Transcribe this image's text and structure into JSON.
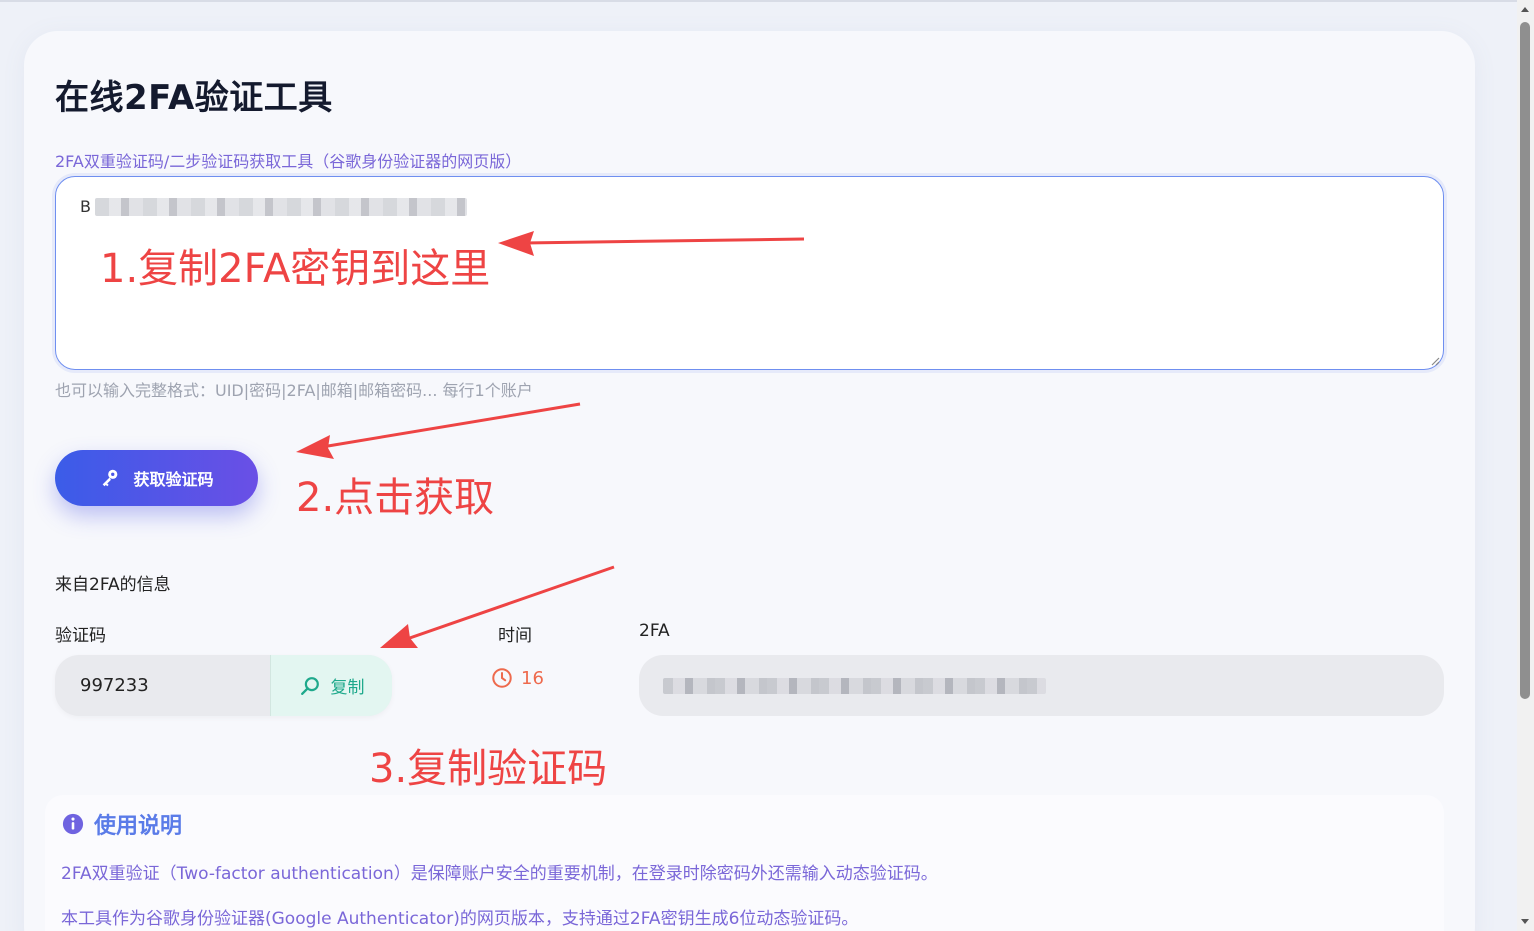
{
  "app": {
    "title": "在线2FA验证工具",
    "subtitle": "2FA双重验证码/二步验证码获取工具（谷歌身份验证器的网页版）",
    "secret_input": {
      "visible_prefix": "B"
    },
    "hint": "也可以输入完整格式：UID|密码|2FA|邮箱|邮箱密码... 每行1个账户",
    "get_button_label": "获取验证码",
    "result_section_label": "来自2FA的信息",
    "columns": {
      "code": "验证码",
      "time": "时间",
      "twofa": "2FA"
    },
    "code_value": "997233",
    "copy_button_label": "复制",
    "time_remaining": "16",
    "help": {
      "title": "使用说明",
      "line1": "2FA双重验证（Two-factor authentication）是保障账户安全的重要机制，在登录时除密码外还需输入动态验证码。",
      "line2": "本工具作为谷歌身份验证器(Google Authenticator)的网页版本，支持通过2FA密钥生成6位动态验证码。"
    }
  },
  "annotations": {
    "step1": "1.复制2FA密钥到这里",
    "step2": "2.点击获取",
    "step3": "3.复制验证码"
  },
  "colors": {
    "accent_start": "#3b5ce8",
    "accent_end": "#6a4fe6",
    "annotation": "#ee4444",
    "copy_green": "#1fa98c",
    "timer_orange": "#ee6a4d",
    "subtitle_purple": "#7a67d8"
  },
  "icons": {
    "get_button": "key-icon",
    "copy_button": "search-icon",
    "timer": "clock-icon",
    "help": "info-icon"
  }
}
